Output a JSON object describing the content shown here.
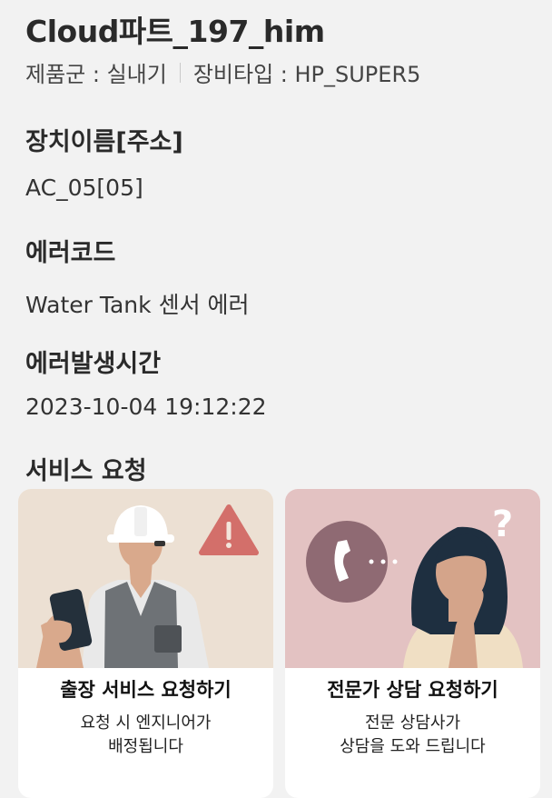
{
  "device": {
    "title": "Cloud파트_197_him",
    "product_group": "제품군 : 실내기",
    "equipment_type": "장비타입 : HP_SUPER5"
  },
  "fields": {
    "device_name_label": "장치이름[주소]",
    "device_name_value": "AC_05[05]",
    "error_code_label": "에러코드",
    "error_code_value": "Water Tank 센서 에러",
    "error_time_label": "에러발생시간",
    "error_time_value": "2023-10-04 19:12:22"
  },
  "service": {
    "section_label": "서비스 요청",
    "cards": [
      {
        "title": "출장 서비스 요청하기",
        "subtitle_line1": "요청 시 엔지니어가",
        "subtitle_line2": "배정됩니다",
        "icon": "engineer-warning-icon",
        "bg": "#ece0d3"
      },
      {
        "title": "전문가 상담 요청하기",
        "subtitle_line1": "전문 상담사가",
        "subtitle_line2": "상담을 도와 드립니다",
        "icon": "phone-consultant-icon",
        "bg": "#e3c2c2"
      }
    ]
  }
}
